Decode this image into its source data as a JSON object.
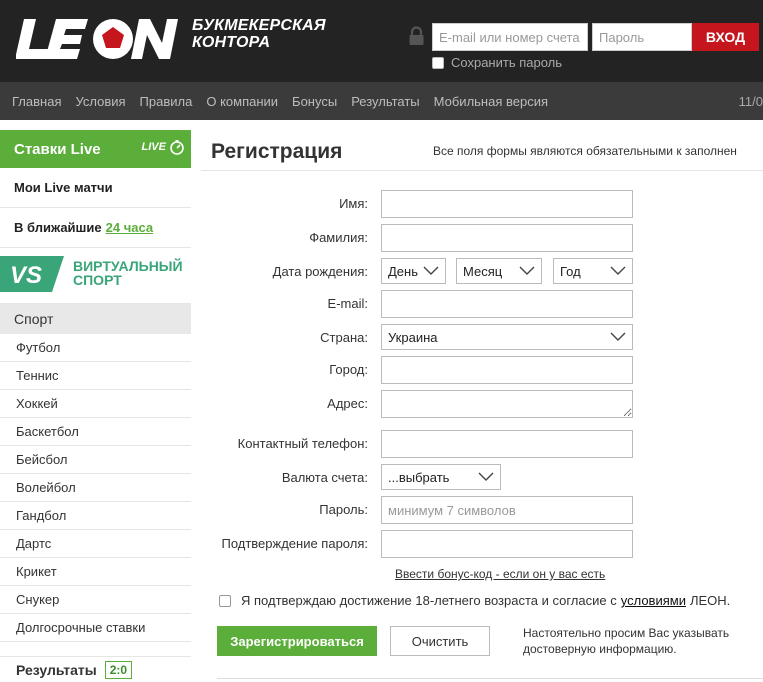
{
  "header": {
    "logo_text": "LEON",
    "tagline_line1": "БУКМЕКЕРСКАЯ",
    "tagline_line2": "КОНТОРА",
    "login": {
      "email_placeholder": "E-mail или номер счета",
      "password_placeholder": "Пароль",
      "login_button": "ВХОД",
      "remember_label": "Сохранить пароль"
    }
  },
  "nav": {
    "items": [
      "Главная",
      "Условия",
      "Правила",
      "О компании",
      "Бонусы",
      "Результаты",
      "Мобильная версия"
    ],
    "date": "11/0"
  },
  "sidebar": {
    "live_label": "Ставки Live",
    "live_badge": "LIVE",
    "my_live": "Мои Live матчи",
    "upcoming_prefix": "В ближайшие",
    "upcoming_link": "24 часа",
    "virtual_badge": "VS",
    "virtual_line1": "ВИРТУАЛЬНЫЙ",
    "virtual_line2": "СПОРТ",
    "sport_header": "Спорт",
    "sports": [
      "Футбол",
      "Теннис",
      "Хоккей",
      "Баскетбол",
      "Бейсбол",
      "Волейбол",
      "Гандбол",
      "Дартс",
      "Крикет",
      "Снукер",
      "Долгосрочные ставки"
    ],
    "results_label": "Результаты",
    "results_score": "2:0"
  },
  "main": {
    "title": "Регистрация",
    "note": "Все поля формы являются обязательными к заполнен",
    "form": {
      "first_name_label": "Имя:",
      "last_name_label": "Фамилия:",
      "birth_label": "Дата рождения:",
      "birth_day": "День",
      "birth_month": "Месяц",
      "birth_year": "Год",
      "email_label": "E-mail:",
      "country_label": "Страна:",
      "country_value": "Украина",
      "city_label": "Город:",
      "address_label": "Адрес:",
      "phone_label": "Контактный телефон:",
      "currency_label": "Валюта счета:",
      "currency_value": "...выбрать",
      "password_label": "Пароль:",
      "password_placeholder": "минимум 7 символов",
      "confirm_label": "Подтверждение пароля:",
      "bonus_link": "Ввести бонус-код - если он у вас есть",
      "agree_prefix": "Я подтверждаю достижение 18-летнего возраста и согласие с",
      "agree_link": "условиями",
      "agree_suffix": "ЛЕОН.",
      "register_button": "Зарегистрироваться",
      "clear_button": "Очистить",
      "footer_note": "Настоятельно просим Вас указывать достоверную информацию."
    }
  },
  "colors": {
    "brand_red": "#c4161c",
    "accent_green": "#5cae3b",
    "virtual_teal": "#3aa579",
    "header_bg": "#232323",
    "nav_bg": "#3b3b3b"
  }
}
